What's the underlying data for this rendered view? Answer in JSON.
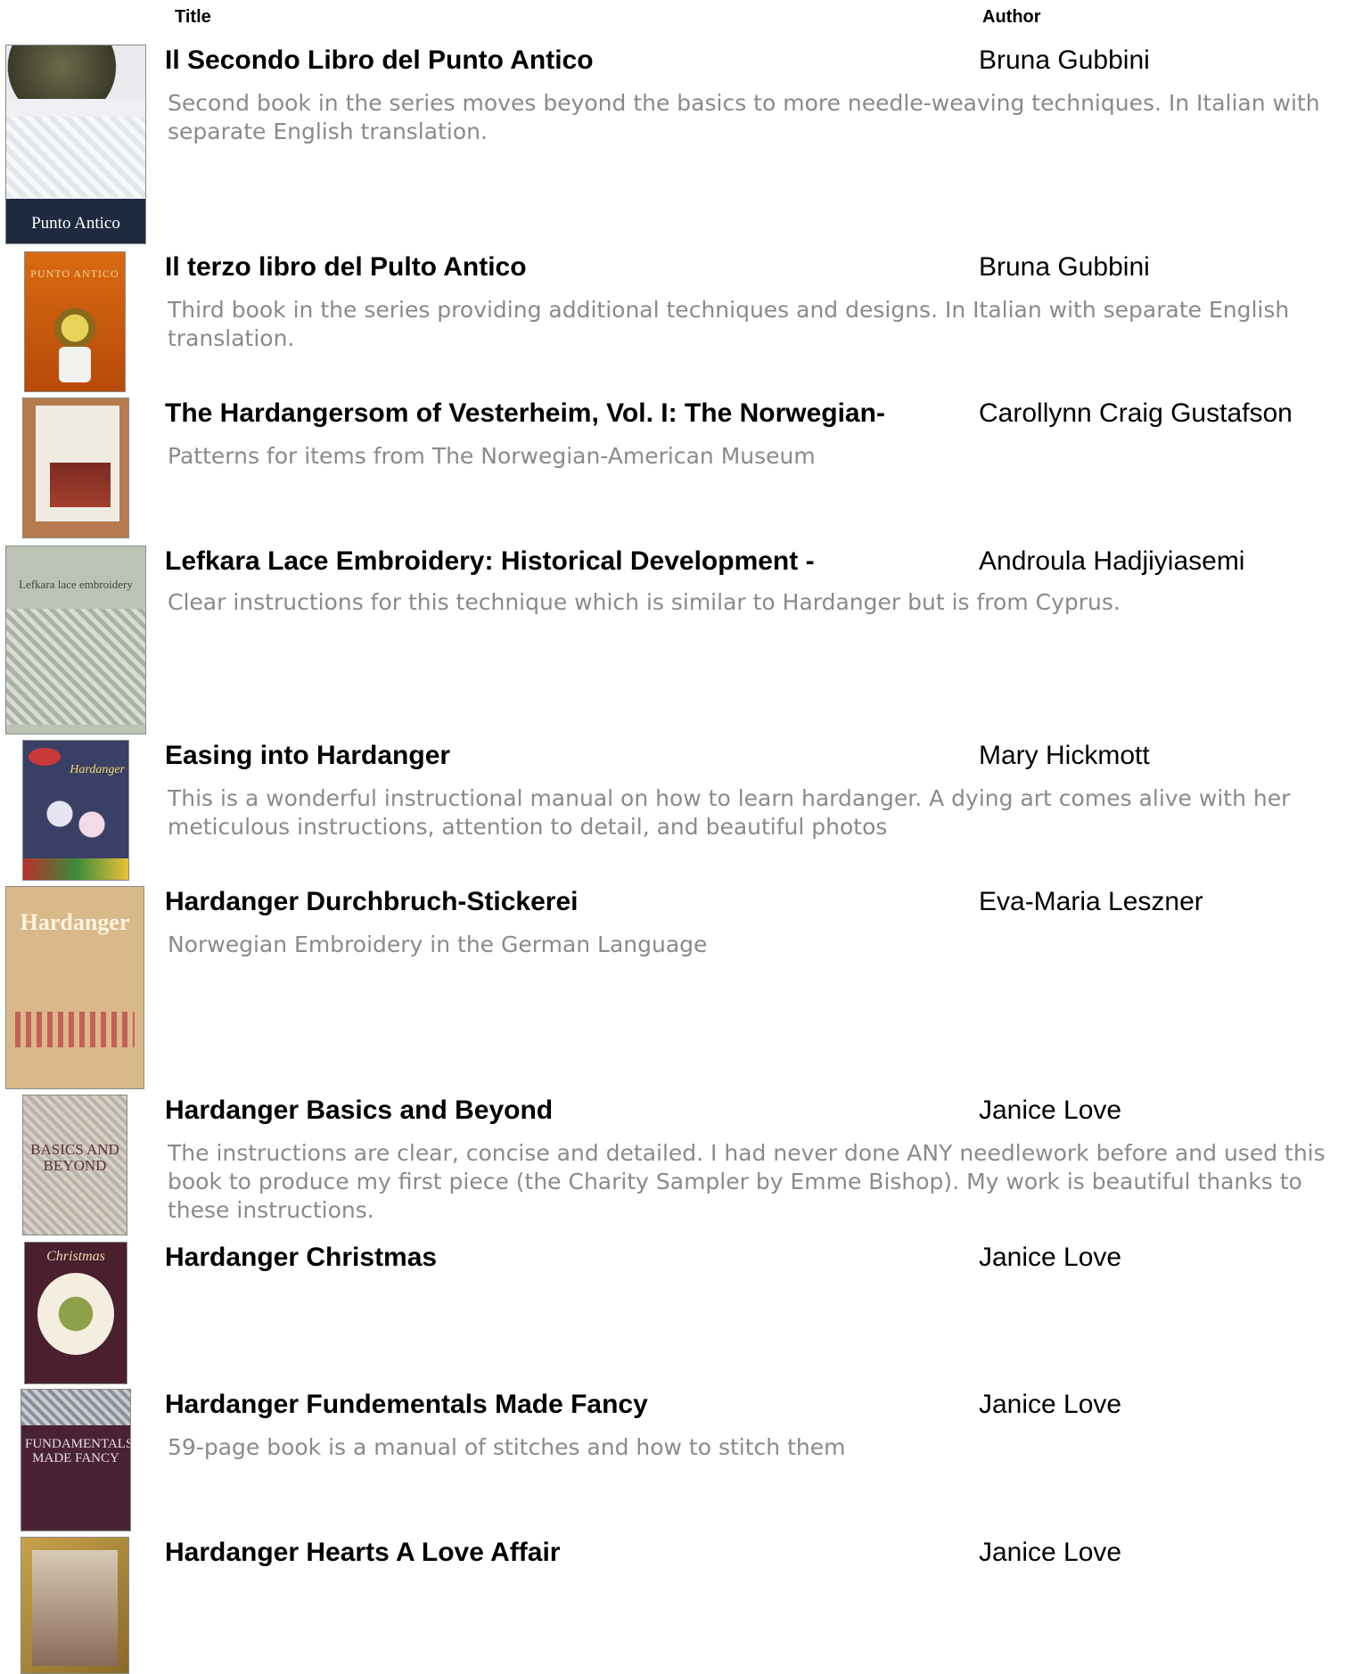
{
  "header": {
    "title_col": "Title",
    "author_col": "Author"
  },
  "colors": {
    "description_text": "#8a8a8a",
    "title_text": "#000000"
  },
  "books": [
    {
      "title": "Il Secondo Libro del Punto Antico",
      "author": "Bruna Gubbini",
      "description": "Second book in the series moves beyond the basics to more needle-weaving techniques.  In Italian with separate English translation.",
      "cover_text": "Punto Antico",
      "cover_icon": "book-cover-image"
    },
    {
      "title": "Il terzo libro del Pulto Antico",
      "author": "Bruna Gubbini",
      "description": "Third book in the series providing additional techniques and designs.  In Italian with separate English translation.",
      "cover_text": "PUNTO ANTICO",
      "cover_icon": "book-cover-image"
    },
    {
      "title": "The Hardangersom of Vesterheim, Vol. I: The Norwegian-",
      "author": "Carollynn Craig Gustafson",
      "description": "Patterns for items from The Norwegian-American Museum",
      "cover_text": "",
      "cover_icon": "book-cover-image"
    },
    {
      "title": "Lefkara Lace Embroidery: Historical Development -",
      "author": "Androula Hadjiyiasemi",
      "description": "Clear instructions for this technique which is similar to Hardanger but is from Cyprus.",
      "cover_text": "Lefkara lace embroidery",
      "cover_icon": "book-cover-image"
    },
    {
      "title": "Easing into Hardanger",
      "author": "Mary Hickmott",
      "description": "This is a wonderful instructional manual on how to learn hardanger. A dying art comes alive with her meticulous instructions, attention to detail, and beautiful photos",
      "cover_text": "Hardanger",
      "cover_icon": "book-cover-image"
    },
    {
      "title": "Hardanger Durchbruch-Stickerei",
      "author": "Eva-Maria Leszner",
      "description": "Norwegian Embroidery in the German Language",
      "cover_text": "Hardanger",
      "cover_icon": "book-cover-image"
    },
    {
      "title": "Hardanger Basics and Beyond",
      "author": "Janice Love",
      "description": "The instructions are clear, concise and detailed. I had never done ANY needlework before and used this book to produce my first piece (the Charity Sampler by Emme Bishop). My work is beautiful thanks to these instructions.",
      "cover_text": "BASICS AND BEYOND",
      "cover_icon": "book-cover-image"
    },
    {
      "title": "Hardanger Christmas",
      "author": "Janice Love",
      "description": "",
      "cover_text": "Christmas",
      "cover_icon": "book-cover-image"
    },
    {
      "title": "Hardanger Fundementals Made Fancy",
      "author": "Janice Love",
      "description": "59-page book is a manual of stitches and how to stitch them",
      "cover_text": "FUNDAMENTALS MADE FANCY",
      "cover_icon": "book-cover-image"
    },
    {
      "title": "Hardanger Hearts A Love Affair",
      "author": "Janice Love",
      "description": "",
      "cover_text": "",
      "cover_icon": "book-cover-image"
    }
  ]
}
